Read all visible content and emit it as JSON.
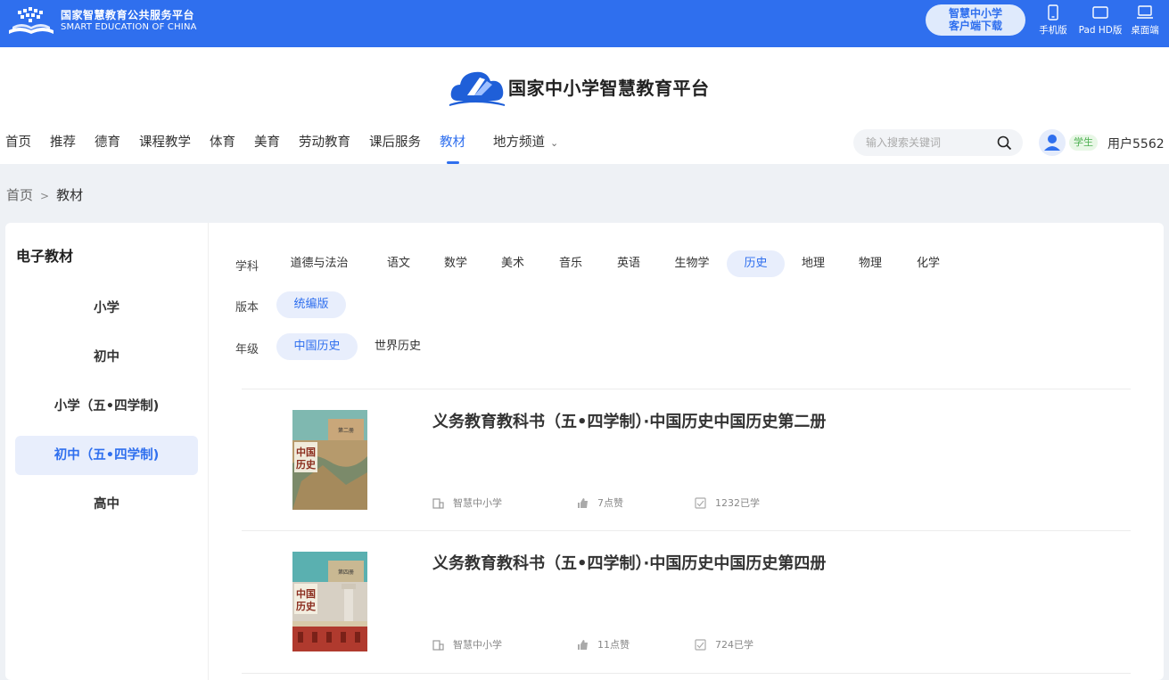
{
  "brand": {
    "name_cn": "国家智慧教育公共服务平台",
    "name_en": "SMART EDUCATION OF CHINA"
  },
  "download": {
    "line1": "智慧中小学",
    "line2": "客户端下载"
  },
  "devices": [
    {
      "label": "手机版",
      "icon": "phone-icon"
    },
    {
      "label": "Pad HD版",
      "icon": "tablet-icon"
    },
    {
      "label": "桌面端",
      "icon": "laptop-icon"
    }
  ],
  "platform": {
    "name": "国家中小学智慧教育平台"
  },
  "nav": {
    "items": [
      "首页",
      "推荐",
      "德育",
      "课程教学",
      "体育",
      "美育",
      "劳动教育",
      "课后服务",
      "教材",
      "地方频道"
    ],
    "active": "教材"
  },
  "search": {
    "placeholder": "输入搜索关键词"
  },
  "user": {
    "role": "学生",
    "name": "用户5562"
  },
  "breadcrumb": {
    "home": "首页",
    "separator": ">",
    "current": "教材"
  },
  "sidebar": {
    "title": "电子教材",
    "items": [
      "小学",
      "初中",
      "小学（五•四学制)",
      "初中（五•四学制)",
      "高中"
    ],
    "active": "初中（五•四学制)"
  },
  "filters": {
    "subject": {
      "label": "学科",
      "options": [
        "道德与法治",
        "语文",
        "数学",
        "美术",
        "音乐",
        "英语",
        "生物学",
        "历史",
        "地理",
        "物理",
        "化学"
      ],
      "active": "历史"
    },
    "edition": {
      "label": "版本",
      "options": [
        "统编版"
      ],
      "active": "统编版"
    },
    "grade": {
      "label": "年级",
      "options": [
        "中国历史",
        "世界历史"
      ],
      "active": "中国历史"
    }
  },
  "books": [
    {
      "title": "义务教育教科书（五•四学制）·中国历史中国历史第二册",
      "source": "智慧中小学",
      "likes": "7点赞",
      "learned": "1232已学",
      "cover_text": "中国历史",
      "cover_tag": "第二册"
    },
    {
      "title": "义务教育教科书（五•四学制）·中国历史中国历史第四册",
      "source": "智慧中小学",
      "likes": "11点赞",
      "learned": "724已学",
      "cover_text": "中国历史",
      "cover_tag": "第四册"
    }
  ],
  "colors": {
    "primary": "#2f6fee",
    "active_bg": "#e8eefc",
    "page_bg": "#eef1f5",
    "role_green": "#4cb050"
  }
}
